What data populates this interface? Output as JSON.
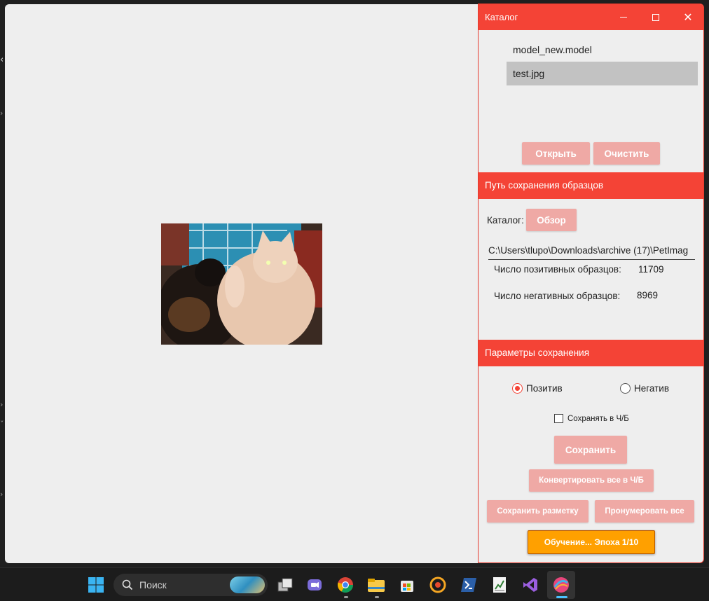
{
  "catalog": {
    "title": "Каталог",
    "files": [
      "model_new.model",
      "test.jpg"
    ],
    "selected_index": 1,
    "open_label": "Открыть",
    "clear_label": "Очистить"
  },
  "samples_path": {
    "header": "Путь сохранения образцов",
    "folder_label": "Каталог:",
    "browse_label": "Обзор",
    "path_value": "C:\\Users\\tlupo\\Downloads\\archive (17)\\PetImag",
    "positive_label": "Число позитивных образцов:",
    "positive_count": "11709",
    "negative_label": "Число негативных образцов:",
    "negative_count": "8969"
  },
  "save_params": {
    "header": "Параметры сохранения",
    "positive_radio": "Позитив",
    "negative_radio": "Негатив",
    "selected_radio": "positive",
    "bw_checkbox": "Сохранять в Ч/Б",
    "bw_checked": false,
    "save_label": "Сохранить",
    "convert_bw_label": "Конвертировать все в Ч/Б",
    "save_markup_label": "Сохранить разметку",
    "number_all_label": "Пронумеровать все",
    "training_label": "Обучение... Эпоха 1/10"
  },
  "taskbar": {
    "search_label": "Поиск",
    "icons": [
      "windows-start-icon",
      "search-icon",
      "task-view-icon",
      "chat-icon",
      "chrome-icon",
      "file-explorer-icon",
      "store-icon",
      "media-player-icon",
      "powershell-icon",
      "spreadsheet-icon",
      "visual-studio-icon",
      "app-icon"
    ]
  },
  "colors": {
    "accent": "#f44336",
    "button_disabled": "#efa9a5",
    "training": "#ffa000",
    "window_bg": "#eeeeee"
  }
}
